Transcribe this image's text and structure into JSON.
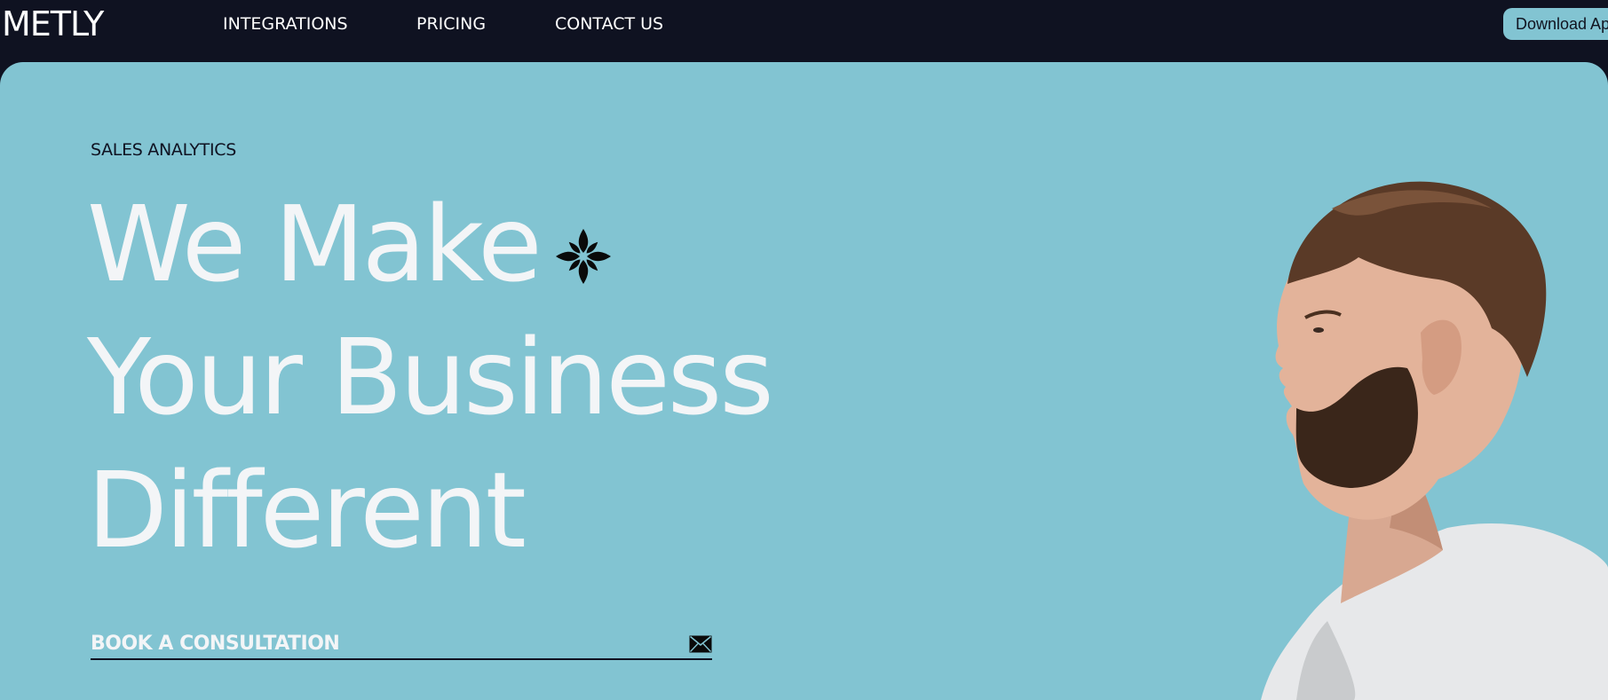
{
  "header": {
    "logo": "METLY",
    "nav": [
      {
        "label": "INTEGRATIONS"
      },
      {
        "label": "PRICING"
      },
      {
        "label": "CONTACT US"
      }
    ],
    "download_label": "Download App"
  },
  "hero": {
    "eyebrow": "SALES ANALYTICS",
    "headline": [
      "We Make",
      "Your Business",
      "Different"
    ],
    "cta_label": "BOOK A CONSULTATION"
  },
  "colors": {
    "nav_background": "#0f1221",
    "hero_background": "#82c4d2",
    "headline_text": "#f3f5f7",
    "button_background": "#82c4d2"
  },
  "icons": {
    "headline_ornament": "flower-icon",
    "cta_icon": "envelope-icon",
    "hero_image": "man-profile-portrait"
  }
}
